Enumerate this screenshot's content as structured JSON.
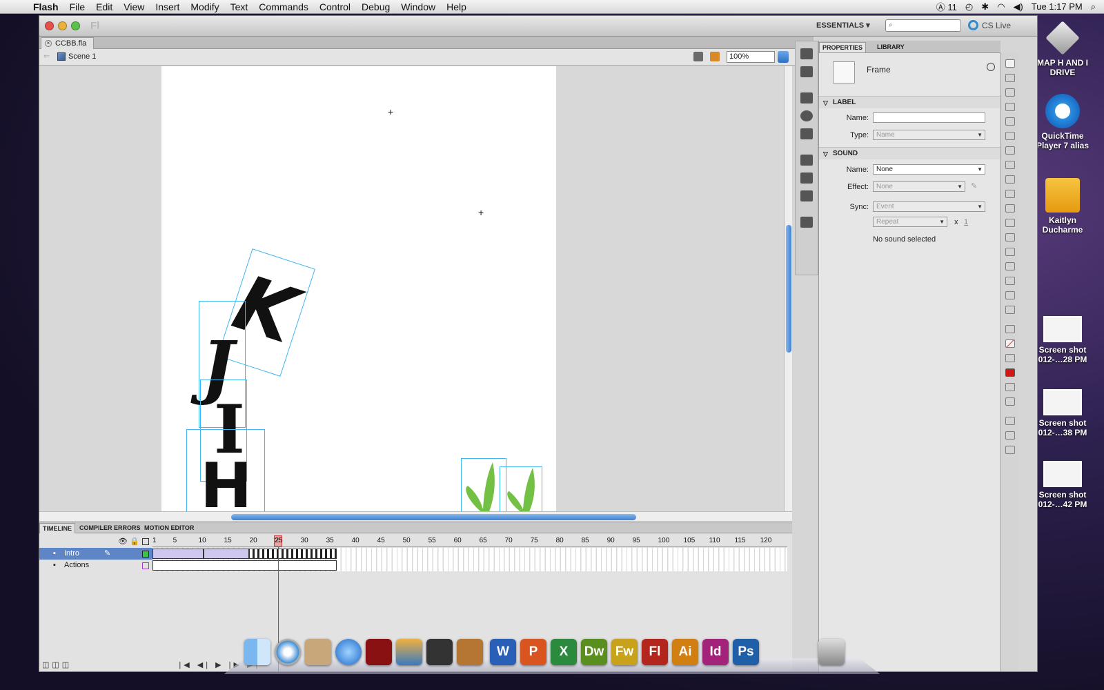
{
  "menubar": {
    "app": "Flash",
    "items": [
      "File",
      "Edit",
      "View",
      "Insert",
      "Modify",
      "Text",
      "Commands",
      "Control",
      "Debug",
      "Window",
      "Help"
    ],
    "status_count": "11",
    "clock": "Tue 1:17 PM"
  },
  "desktop": {
    "icons": [
      {
        "label": "MAP H AND I DRIVE"
      },
      {
        "label": "QuickTime Player 7 alias"
      },
      {
        "label": "Kaitlyn Ducharme"
      },
      {
        "label": "Screen shot 012-…28 PM"
      },
      {
        "label": "Screen shot 012-…38 PM"
      },
      {
        "label": "Screen shot 012-…42 PM"
      }
    ]
  },
  "window": {
    "logo": "Fl",
    "workspace": "ESSENTIALS ▾",
    "cs_live": "CS Live",
    "doc_tab": "CCBB.fla",
    "scene": "Scene 1",
    "zoom": "100%"
  },
  "properties": {
    "tabs": [
      "PROPERTIES",
      "LIBRARY"
    ],
    "object": "Frame",
    "label_section": "LABEL",
    "name_label": "Name:",
    "type_label": "Type:",
    "type_value": "Name",
    "sound_section": "SOUND",
    "sound_name_label": "Name:",
    "sound_name": "None",
    "effect_label": "Effect:",
    "effect_value": "None",
    "sync_label": "Sync:",
    "sync_value": "Event",
    "repeat_value": "Repeat",
    "repeat_x": "x",
    "repeat_count": "1",
    "status": "No sound selected"
  },
  "timeline": {
    "tabs": [
      "TIMELINE",
      "COMPILER ERRORS",
      "MOTION EDITOR"
    ],
    "ruler": [
      "1",
      "5",
      "10",
      "15",
      "20",
      "25",
      "30",
      "35",
      "40",
      "45",
      "50",
      "55",
      "60",
      "65",
      "70",
      "75",
      "80",
      "85",
      "90",
      "95",
      "100",
      "105",
      "110",
      "115",
      "120"
    ],
    "layers": [
      {
        "name": "Intro",
        "selected": true
      },
      {
        "name": "Actions",
        "selected": false
      }
    ],
    "current_frame": 25
  },
  "stage": {
    "letters": [
      "K",
      "J",
      "I",
      "H"
    ]
  },
  "dock": {
    "apps": [
      {
        "label": "W",
        "color": "#2a5fb8"
      },
      {
        "label": "P",
        "color": "#d9541e"
      },
      {
        "label": "X",
        "color": "#2b8a3e"
      },
      {
        "label": "Dw",
        "color": "#5a8f1f"
      },
      {
        "label": "Fw",
        "color": "#c8a21a"
      },
      {
        "label": "Fl",
        "color": "#b3261e"
      },
      {
        "label": "Ai",
        "color": "#d27f12"
      },
      {
        "label": "Id",
        "color": "#a3237a"
      },
      {
        "label": "Ps",
        "color": "#1f5fa8"
      }
    ]
  }
}
